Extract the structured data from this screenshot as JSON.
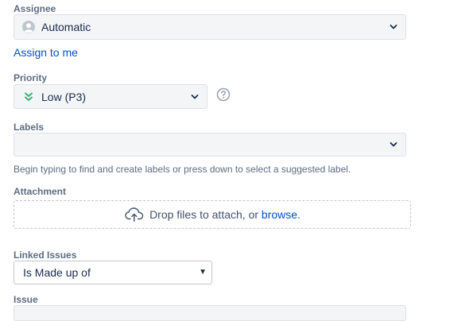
{
  "assignee": {
    "label": "Assignee",
    "value": "Automatic",
    "avatar_icon": "default-avatar-icon",
    "assign_to_me": "Assign to me"
  },
  "priority": {
    "label": "Priority",
    "value": "Low (P3)",
    "priority_icon": "double-chevron-down-icon",
    "priority_color": "#36b37e",
    "help_icon": "question-circle-icon"
  },
  "labels": {
    "label": "Labels",
    "value": "",
    "hint": "Begin typing to find and create labels or press down to select a suggested label."
  },
  "attachment": {
    "label": "Attachment",
    "drop_text": "Drop files to attach, or",
    "browse_text": "browse.",
    "upload_icon": "cloud-upload-icon"
  },
  "linked_issues": {
    "label": "Linked Issues",
    "value": "Is Made up of"
  },
  "issue": {
    "label": "Issue"
  },
  "colors": {
    "link": "#0052cc",
    "field_bg": "#f4f5f7",
    "label_text": "#5e6c84"
  }
}
